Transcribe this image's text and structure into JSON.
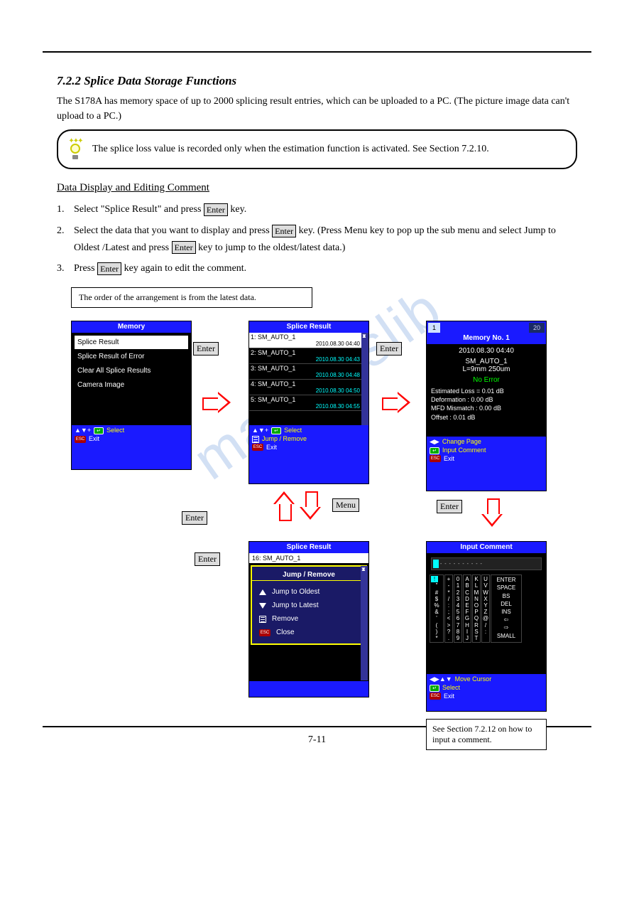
{
  "section_title": "7.2.2 Splice Data Storage Functions",
  "intro": "The S178A has memory space of up to 2000 splicing result entries, which can be uploaded to a PC. (The picture image data can't upload to a PC.)",
  "tip": "The splice loss value is recorded only when the estimation function is activated. See Section 7.2.10.",
  "sub_heading": "Data Display and Editing Comment",
  "steps": {
    "s1a": "Select \"Splice Result\" and press",
    "s1b": "key.",
    "s2a": "Select the data that you want to display and press",
    "s2b": "key. (Press Menu key to pop up the sub menu and select Jump to Oldest /Latest and press",
    "s2c": "key to jump to the oldest/latest data.)",
    "s3a": "Press",
    "s3b": "key again to edit the comment."
  },
  "keys": {
    "enter": "Enter",
    "menu": "Menu"
  },
  "note": "The order of the arrangement is from the latest data.",
  "see_also": "See Section 7.2.12 on how to input a comment.",
  "page_number": "7-11",
  "screen_memory": {
    "title": "Memory",
    "rows": [
      "Splice Result",
      "Splice Result of Error",
      "Clear All Splice Results",
      "Camera Image"
    ],
    "footer": {
      "avplus": "▲▼+",
      "select": "Select",
      "exit": "Exit"
    }
  },
  "screen_splice_list": {
    "title": "Splice Result",
    "items": [
      {
        "label": "1: SM_AUTO_1",
        "date": "2010.08.30  04:40"
      },
      {
        "label": "2: SM_AUTO_1",
        "date": "2010.08.30  04:43"
      },
      {
        "label": "3: SM_AUTO_1",
        "date": "2010.08.30  04:48"
      },
      {
        "label": "4: SM_AUTO_1",
        "date": "2010.08.30  04:50"
      },
      {
        "label": "5: SM_AUTO_1",
        "date": "2010.08.30  04:55"
      }
    ],
    "footer": {
      "avplus": "▲▼+",
      "select": "Select",
      "jump": "Jump / Remove",
      "exit": "Exit"
    }
  },
  "screen_detail": {
    "tab_left": "1",
    "tab_right": "20",
    "title": "Memory No. 1",
    "date": "2010.08.30  04:40",
    "fiber": "SM_AUTO_1",
    "lens": "L=9mm  250um",
    "noerror": "No Error",
    "stats": [
      "Estimated Loss = 0.01 dB",
      "Deformation    : 0.00 dB",
      "MFD Mismatch   : 0.00 dB",
      "Offset         : 0.01 dB"
    ],
    "footer": {
      "change": "Change Page",
      "input": "Input Comment",
      "exit": "Exit"
    }
  },
  "screen_popup": {
    "title": "Splice Result",
    "topitem": "16: SM_AUTO_1",
    "popup_title": "Jump / Remove",
    "rows": [
      "Jump to Oldest",
      "Jump to Latest",
      "Remove",
      "Close"
    ]
  },
  "screen_input": {
    "title": "Input Comment",
    "cols": {
      "c1": [
        "!",
        "+",
        "\"",
        "-",
        "#",
        "*",
        "$",
        "/",
        "%",
        ":",
        "&",
        ";",
        "'",
        "<",
        "(",
        ">",
        ")",
        "?",
        "*",
        "."
      ],
      "c2": [
        "0",
        "1",
        "2",
        "3",
        "4",
        "5",
        "6",
        "7",
        "8",
        "9"
      ],
      "c3": [
        "A",
        "B",
        "C",
        "D",
        "E",
        "F",
        "G",
        "H",
        "I",
        "J"
      ],
      "c4": [
        "K",
        "L",
        "M",
        "N",
        "O",
        "P",
        "Q",
        "R",
        "S",
        "T"
      ],
      "c5": [
        "U",
        "V",
        "W",
        "X",
        "Y",
        "Z",
        " ",
        "@",
        "/",
        ":"
      ],
      "c6": [
        "ENTER",
        "",
        "SPACE",
        "BS",
        "DEL",
        "INS",
        "⇦",
        "⇨",
        "",
        "SMALL"
      ]
    },
    "footer": {
      "move": "Move Cursor",
      "select": "Select",
      "exit": "Exit"
    }
  }
}
